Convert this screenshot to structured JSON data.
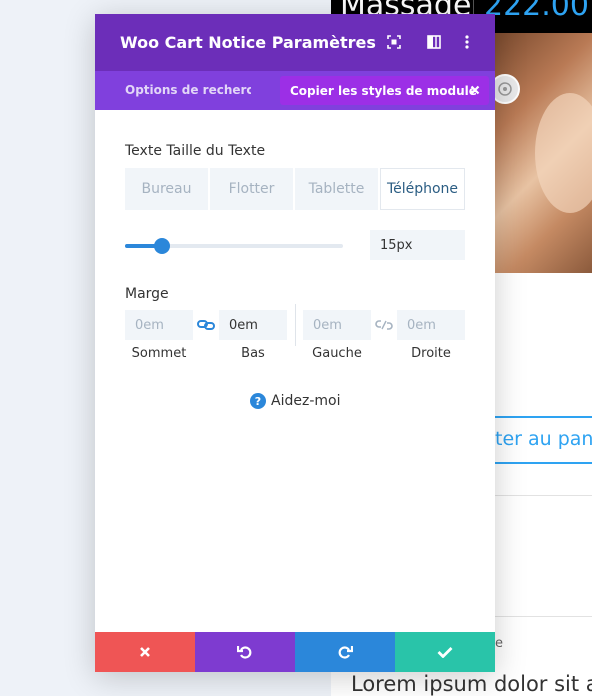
{
  "background_page": {
    "product_title": "Massage",
    "price": "222.00",
    "cart_button_text": "ter au pani",
    "small_text": "e",
    "lorem_text": "Lorem ipsum dolor sit a"
  },
  "modal": {
    "title": "Woo Cart Notice Paramètres",
    "header_icons": [
      "focus-icon",
      "columns-icon",
      "more-vertical-icon"
    ],
    "tabs": {
      "search_label": "Options de recherche",
      "copy_styles_label": "Copier les styles de module"
    },
    "text_size": {
      "label": "Texte Taille du Texte",
      "devices": [
        "Bureau",
        "Flotter",
        "Tablette",
        "Téléphone"
      ],
      "active_device": "Téléphone",
      "value": "15px",
      "slider_fraction": 0.17
    },
    "margin": {
      "label": "Marge",
      "fields": [
        {
          "caption": "Sommet",
          "value": "",
          "placeholder": "0em"
        },
        {
          "caption": "Bas",
          "value": "0em",
          "placeholder": "0em"
        },
        {
          "caption": "Gauche",
          "value": "",
          "placeholder": "0em"
        },
        {
          "caption": "Droite",
          "value": "",
          "placeholder": "0em"
        }
      ],
      "top_bottom_linked": true,
      "left_right_linked": false
    },
    "help": {
      "label": "Aidez-moi",
      "icon": "?"
    },
    "footer": [
      {
        "name": "cancel",
        "icon": "close-icon",
        "color": "#ef5555"
      },
      {
        "name": "undo",
        "icon": "undo-icon",
        "color": "#7e3bd0"
      },
      {
        "name": "redo",
        "icon": "redo-icon",
        "color": "#2b87da"
      },
      {
        "name": "save",
        "icon": "check-icon",
        "color": "#29c4a9"
      }
    ]
  },
  "colors": {
    "header": "#6c2eb9",
    "tabs_bar": "#8040dd",
    "copy_pill": "#9c2fe6",
    "accent_blue": "#2b87da",
    "link_blue": "#2ea3f2"
  }
}
